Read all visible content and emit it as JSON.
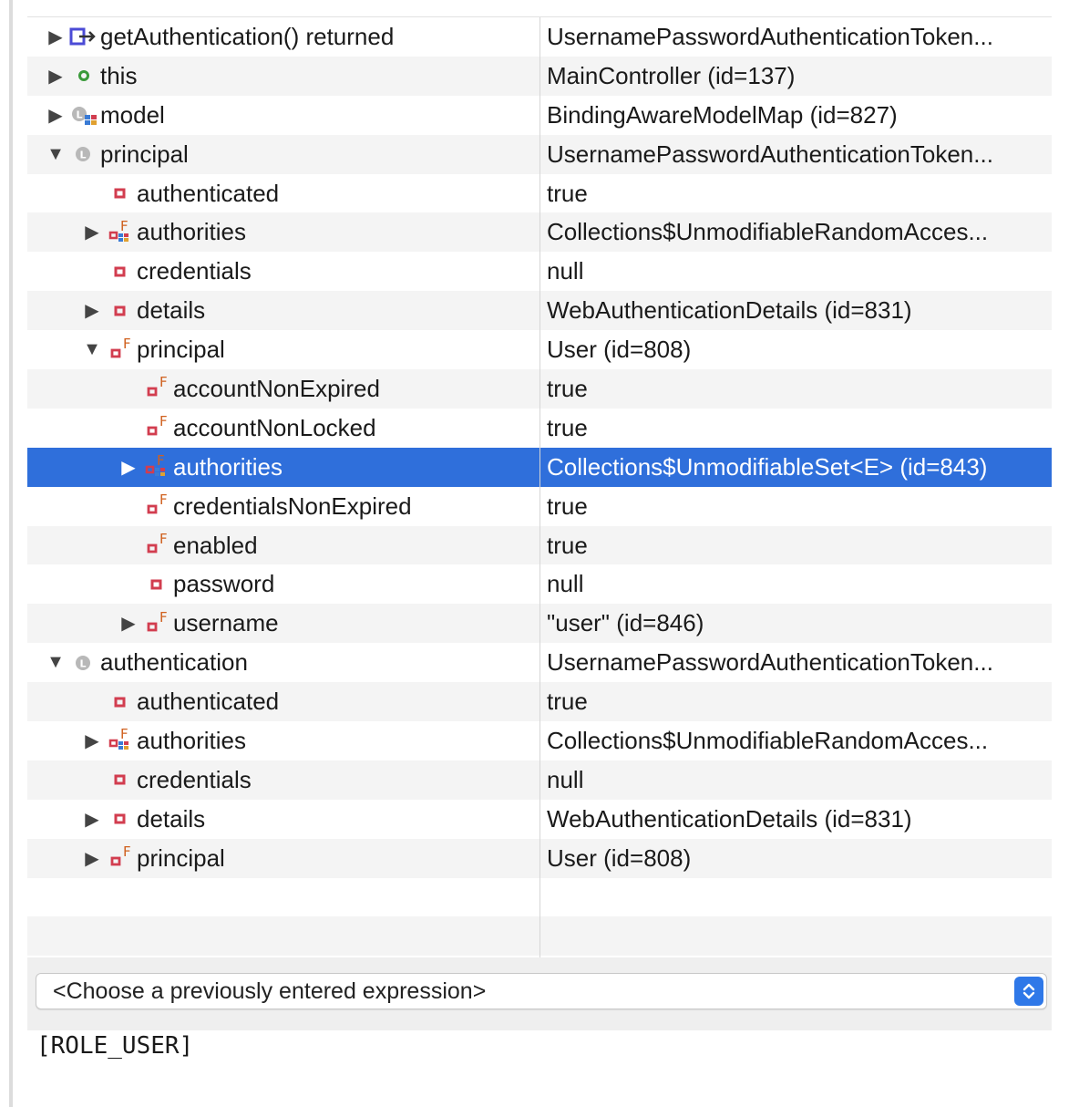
{
  "variables": {
    "rows": [
      {
        "name": "getAuthentication() returned",
        "value": "UsernamePasswordAuthenticationToken...",
        "icon": "method-return-icon",
        "level": 0,
        "expander": "collapsed"
      },
      {
        "name": "this",
        "value": "MainController  (id=137)",
        "icon": "local-variable-icon",
        "level": 0,
        "expander": "collapsed"
      },
      {
        "name": "model",
        "value": "BindingAwareModelMap  (id=827)",
        "icon": "interface-variable-icon",
        "level": 0,
        "expander": "collapsed"
      },
      {
        "name": "principal",
        "value": "UsernamePasswordAuthenticationToken...",
        "icon": "parameter-icon",
        "level": 0,
        "expander": "expanded"
      },
      {
        "name": "authenticated",
        "value": "true",
        "icon": "private-field-icon",
        "level": 1,
        "expander": "none"
      },
      {
        "name": "authorities",
        "value": "Collections$UnmodifiableRandomAcces...",
        "icon": "private-final-collection-field-icon",
        "level": 1,
        "expander": "collapsed"
      },
      {
        "name": "credentials",
        "value": "null",
        "icon": "private-field-icon",
        "level": 1,
        "expander": "none"
      },
      {
        "name": "details",
        "value": "WebAuthenticationDetails  (id=831)",
        "icon": "private-field-icon",
        "level": 1,
        "expander": "collapsed"
      },
      {
        "name": "principal",
        "value": "User  (id=808)",
        "icon": "private-final-field-icon",
        "level": 1,
        "expander": "expanded"
      },
      {
        "name": "accountNonExpired",
        "value": "true",
        "icon": "private-final-field-icon",
        "level": 2,
        "expander": "none"
      },
      {
        "name": "accountNonLocked",
        "value": "true",
        "icon": "private-final-field-icon",
        "level": 2,
        "expander": "none"
      },
      {
        "name": "authorities",
        "value": "Collections$UnmodifiableSet<E>  (id=843)",
        "icon": "private-final-collection-field-icon",
        "level": 2,
        "expander": "collapsed",
        "selected": true
      },
      {
        "name": "credentialsNonExpired",
        "value": "true",
        "icon": "private-final-field-icon",
        "level": 2,
        "expander": "none"
      },
      {
        "name": "enabled",
        "value": "true",
        "icon": "private-final-field-icon",
        "level": 2,
        "expander": "none"
      },
      {
        "name": "password",
        "value": "null",
        "icon": "private-field-icon",
        "level": 2,
        "expander": "none"
      },
      {
        "name": "username",
        "value": "\"user\" (id=846)",
        "icon": "private-final-field-icon",
        "level": 2,
        "expander": "collapsed"
      },
      {
        "name": "authentication",
        "value": "UsernamePasswordAuthenticationToken...",
        "icon": "parameter-icon",
        "level": 0,
        "expander": "expanded"
      },
      {
        "name": "authenticated",
        "value": "true",
        "icon": "private-field-icon",
        "level": 1,
        "expander": "none"
      },
      {
        "name": "authorities",
        "value": "Collections$UnmodifiableRandomAcces...",
        "icon": "private-final-collection-field-icon",
        "level": 1,
        "expander": "collapsed"
      },
      {
        "name": "credentials",
        "value": "null",
        "icon": "private-field-icon",
        "level": 1,
        "expander": "none"
      },
      {
        "name": "details",
        "value": "WebAuthenticationDetails  (id=831)",
        "icon": "private-field-icon",
        "level": 1,
        "expander": "collapsed"
      },
      {
        "name": "principal",
        "value": "User  (id=808)",
        "icon": "private-final-field-icon",
        "level": 1,
        "expander": "collapsed"
      }
    ],
    "empty_rows": 2
  },
  "expression": {
    "placeholder": "<Choose a previously entered expression>",
    "stepper_icon": "up-down-chevron-icon"
  },
  "result": {
    "text": "[ROLE_USER]"
  },
  "colors": {
    "selection": "#2f6fdb",
    "private_field": "#d23d4f",
    "final_marker": "#d0601e",
    "local_variable": "#3a9a3a",
    "method_return": "#4b4bd6"
  }
}
